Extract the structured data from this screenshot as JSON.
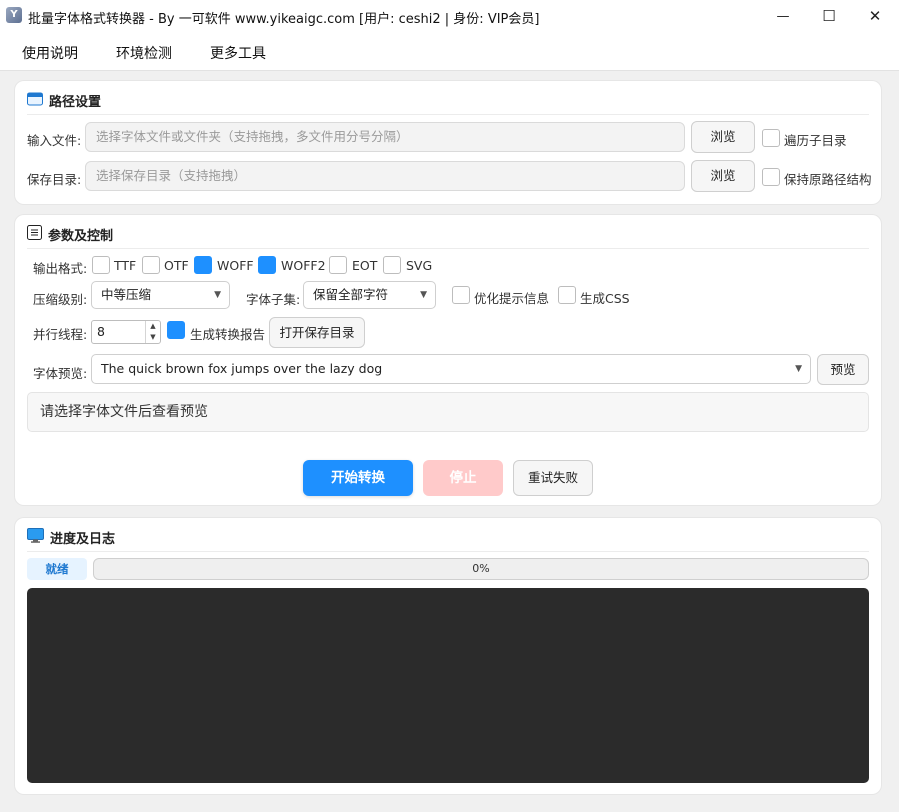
{
  "window": {
    "title": "批量字体格式转换器 - By 一可软件 www.yikeaigc.com [用户: ceshi2 | 身份: VIP会员]",
    "app_icon_glyph": "Y",
    "minimize_glyph": "—",
    "maximize_glyph": "☐",
    "close_glyph": "✕"
  },
  "menu": {
    "items": [
      "使用说明",
      "环境检测",
      "更多工具"
    ]
  },
  "path_panel": {
    "title": "路径设置",
    "icon": "folder-icon",
    "input_label": "输入文件:",
    "input_placeholder": "选择字体文件或文件夹（支持拖拽，多文件用分号分隔）",
    "input_browse": "浏览",
    "recursive_label": "遍历子目录",
    "recursive_checked": false,
    "output_label": "保存目录:",
    "output_placeholder": "选择保存目录（支持拖拽）",
    "output_browse": "浏览",
    "keep_structure_label": "保持原路径结构",
    "keep_structure_checked": false
  },
  "params_panel": {
    "title": "参数及控制",
    "icon": "list-icon",
    "format_label": "输出格式:",
    "formats": [
      {
        "label": "TTF",
        "checked": false
      },
      {
        "label": "OTF",
        "checked": false
      },
      {
        "label": "WOFF",
        "checked": true
      },
      {
        "label": "WOFF2",
        "checked": true
      },
      {
        "label": "EOT",
        "checked": false
      },
      {
        "label": "SVG",
        "checked": false
      }
    ],
    "compression_label": "压缩级别:",
    "compression_value": "中等压缩",
    "subset_label": "字体子集:",
    "subset_value": "保留全部字符",
    "optimize_hint_label": "优化提示信息",
    "optimize_hint_checked": false,
    "gen_css_label": "生成CSS",
    "gen_css_checked": false,
    "threads_label": "并行线程:",
    "threads_value": "8",
    "report_label": "生成转换报告",
    "report_checked": true,
    "open_dir_button": "打开保存目录",
    "preview_label": "字体预览:",
    "preview_text": "The quick brown fox jumps over the lazy dog",
    "preview_button": "预览",
    "preview_placeholder": "请选择字体文件后查看预览",
    "start_button": "开始转换",
    "stop_button": "停止",
    "retry_button": "重试失败"
  },
  "log_panel": {
    "title": "进度及日志",
    "icon": "monitor-icon",
    "status": "就绪",
    "progress_value": 0,
    "progress_text": "0%"
  },
  "colors": {
    "accent": "#1e90ff",
    "stop_disabled": "#ffcaca",
    "log_bg": "#2b2b2b"
  }
}
